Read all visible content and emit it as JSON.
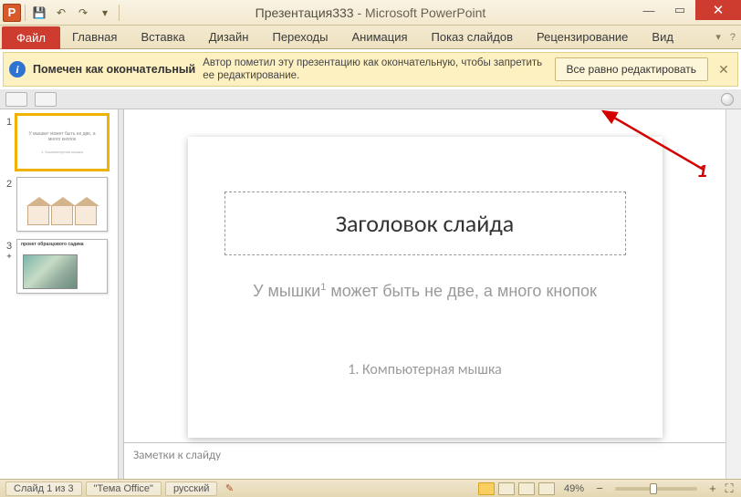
{
  "title": {
    "document": "Презентация333",
    "app": "Microsoft PowerPoint",
    "sep": " - "
  },
  "file_tab": "Файл",
  "tabs": [
    "Главная",
    "Вставка",
    "Дизайн",
    "Переходы",
    "Анимация",
    "Показ слайдов",
    "Рецензирование",
    "Вид"
  ],
  "info_bar": {
    "title": "Помечен как окончательный",
    "message": "Автор пометил эту презентацию как окончательную, чтобы запретить ее редактирование.",
    "button": "Все равно редактировать"
  },
  "slides": [
    {
      "num": "1"
    },
    {
      "num": "2"
    },
    {
      "num": "3"
    }
  ],
  "slide_content": {
    "title": "Заголовок слайда",
    "subtitle_pre": "У мышки",
    "subtitle_sup": "1",
    "subtitle_post": " может быть не две, а много кнопок",
    "footnote": "1. Компьютерная мышка"
  },
  "notes_placeholder": "Заметки к слайду",
  "status": {
    "slide_counter": "Слайд 1 из 3",
    "theme": "\"Тема Office\"",
    "language": "русский",
    "zoom_pct": "49%"
  },
  "annotation": {
    "label": "1"
  },
  "glyphs": {
    "info": "i",
    "close_x": "✕",
    "minimize": "—",
    "maximize": "▭",
    "help": "?",
    "collapse": "▾",
    "minus": "−",
    "plus": "+",
    "fit": "⛶"
  }
}
